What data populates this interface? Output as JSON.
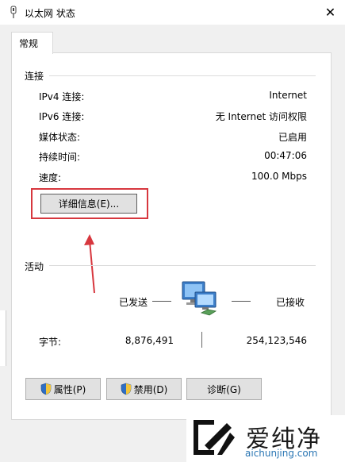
{
  "window": {
    "title": "以太网 状态",
    "close_glyph": "✕"
  },
  "tab": {
    "label": "常规"
  },
  "connection": {
    "group_label": "连接",
    "rows": [
      {
        "label": "IPv4 连接:",
        "value": "Internet"
      },
      {
        "label": "IPv6 连接:",
        "value": "无 Internet 访问权限"
      },
      {
        "label": "媒体状态:",
        "value": "已启用"
      },
      {
        "label": "持续时间:",
        "value": "00:47:06"
      },
      {
        "label": "速度:",
        "value": "100.0 Mbps"
      }
    ],
    "details_button": "详细信息(E)..."
  },
  "activity": {
    "group_label": "活动",
    "sent_label": "已发送",
    "received_label": "已接收",
    "bytes_label": "字节:",
    "bytes_sent": "8,876,491",
    "bytes_received": "254,123,546"
  },
  "buttons": {
    "properties": "属性(P)",
    "disable": "禁用(D)",
    "diagnose": "诊断(G)"
  },
  "watermark": {
    "name": "爱纯净",
    "url": "aichunjing.com"
  },
  "colors": {
    "highlight": "#d7373e",
    "accent": "#2a76b4"
  }
}
